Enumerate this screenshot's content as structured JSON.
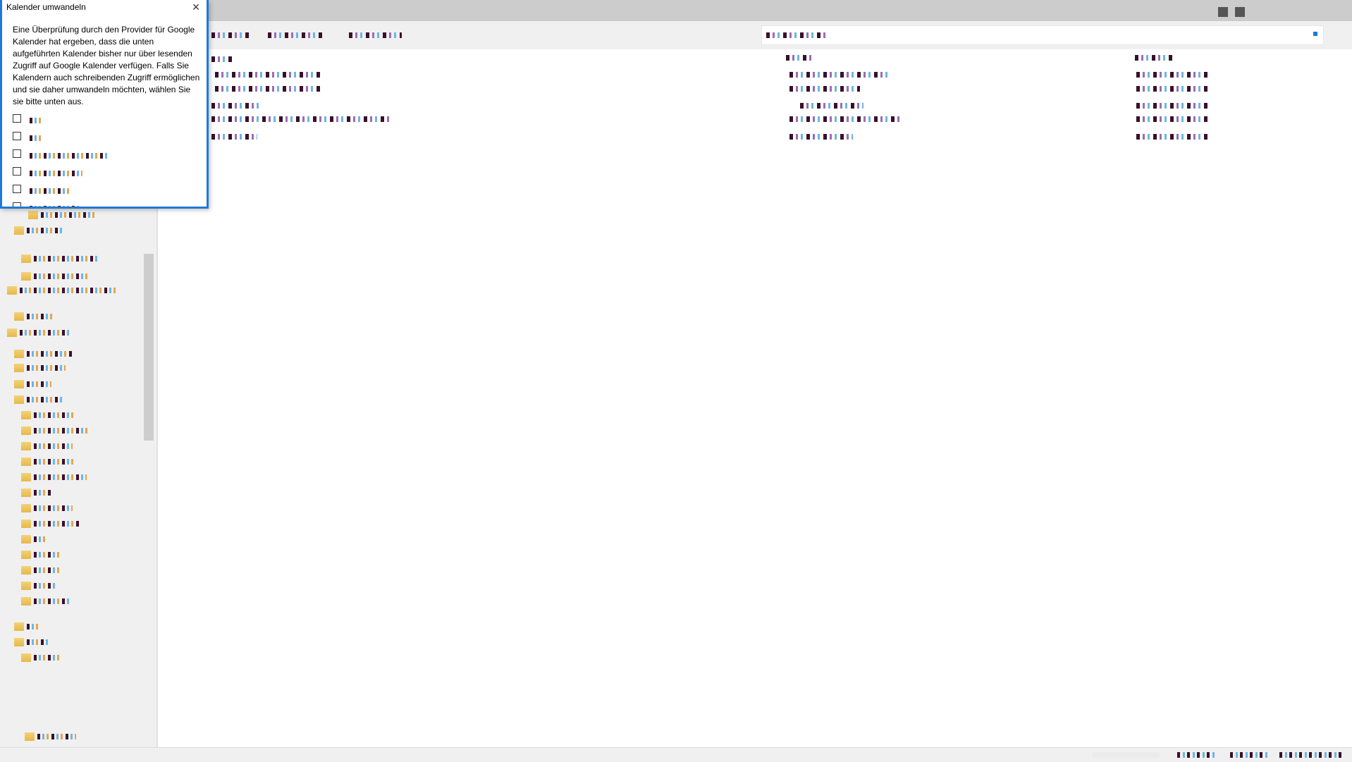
{
  "window": {
    "title": ""
  },
  "dialog": {
    "title": "Kalender umwandeln",
    "close_icon": "close-icon",
    "message": "Eine Überprüfung durch den Provider für Google Kalender hat ergeben, dass die unten aufgeführten Kalender bisher nur über lesenden Zugriff auf Google Kalender verfügen. Falls Sie Kalendern auch schreibenden Zugriff ermöglichen und sie daher umwandeln möchten, wählen Sie sie bitte unten aus.",
    "calendars": [
      {
        "label": "",
        "checked": false
      },
      {
        "label": "",
        "checked": false
      },
      {
        "label": "",
        "checked": false
      },
      {
        "label": "",
        "checked": false
      },
      {
        "label": "",
        "checked": false
      },
      {
        "label": "",
        "checked": false
      }
    ]
  },
  "colors": {
    "accent": "#1e7ad6",
    "titlebar": "#cccccc",
    "toolbar": "#f0f0f0",
    "folder": "#e7b84a"
  }
}
